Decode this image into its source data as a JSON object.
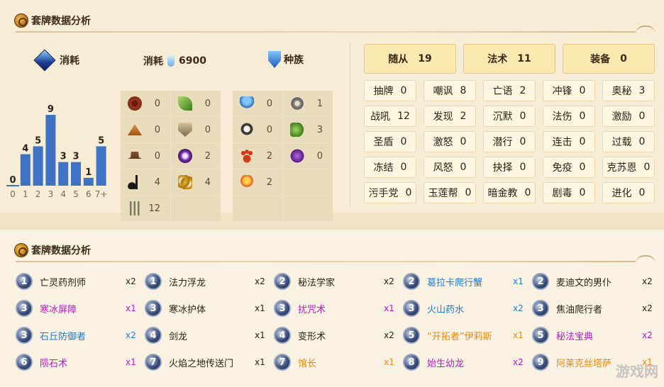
{
  "section_top": {
    "title": "套牌数据分析"
  },
  "section_bottom": {
    "title": "套牌数据分析"
  },
  "stats": {
    "cost_label": "消耗",
    "dust_label": "消耗",
    "dust_value": "6900",
    "race_label": "种族"
  },
  "chart_data": {
    "type": "bar",
    "categories": [
      "0",
      "1",
      "2",
      "3",
      "4",
      "5",
      "6",
      "7+"
    ],
    "values": [
      0,
      4,
      5,
      9,
      3,
      3,
      1,
      5
    ],
    "title": "",
    "xlabel": "",
    "ylabel": "",
    "ylim": [
      0,
      9
    ],
    "grid": false,
    "color": "#3d72c4"
  },
  "type_grid": [
    [
      {
        "icon": "spider-icon",
        "count": "0"
      },
      {
        "icon": "leaf-icon",
        "count": "0"
      }
    ],
    [
      {
        "icon": "pyramid-icon",
        "count": "0"
      },
      {
        "icon": "shield-icon",
        "count": "0"
      }
    ],
    [
      {
        "icon": "hat-icon",
        "count": "0"
      },
      {
        "icon": "purple-eye-icon",
        "count": "2"
      }
    ],
    [
      {
        "icon": "music-note-icon",
        "count": "4"
      },
      {
        "icon": "chain-icon",
        "count": "4"
      }
    ],
    [
      {
        "icon": "claw-icon",
        "count": "12"
      },
      {
        "icon": "",
        "count": ""
      }
    ]
  ],
  "race_grid": [
    [
      {
        "icon": "murloc-icon",
        "count": "0"
      },
      {
        "icon": "gear-icon",
        "count": "1"
      }
    ],
    [
      {
        "icon": "pirate-icon",
        "count": "0"
      },
      {
        "icon": "dragon-icon",
        "count": "3"
      }
    ],
    [
      {
        "icon": "paw-icon",
        "count": "2"
      },
      {
        "icon": "demon-icon",
        "count": "0"
      }
    ],
    [
      {
        "icon": "elemental-icon",
        "count": "2"
      },
      {
        "icon": "",
        "count": ""
      }
    ],
    [
      {
        "icon": "",
        "count": ""
      },
      {
        "icon": "",
        "count": ""
      }
    ]
  ],
  "card_types": [
    {
      "label": "随从",
      "count": "19"
    },
    {
      "label": "法术",
      "count": "11"
    },
    {
      "label": "装备",
      "count": "0"
    }
  ],
  "keywords": [
    [
      {
        "label": "抽牌",
        "count": "0"
      },
      {
        "label": "嘲讽",
        "count": "8"
      },
      {
        "label": "亡语",
        "count": "2"
      },
      {
        "label": "冲锋",
        "count": "0"
      },
      {
        "label": "奥秘",
        "count": "3"
      }
    ],
    [
      {
        "label": "战吼",
        "count": "12"
      },
      {
        "label": "发现",
        "count": "2"
      },
      {
        "label": "沉默",
        "count": "0"
      },
      {
        "label": "法伤",
        "count": "0"
      },
      {
        "label": "激励",
        "count": "0"
      }
    ],
    [
      {
        "label": "圣盾",
        "count": "0"
      },
      {
        "label": "激怒",
        "count": "0"
      },
      {
        "label": "潜行",
        "count": "0"
      },
      {
        "label": "连击",
        "count": "0"
      },
      {
        "label": "过载",
        "count": "0"
      }
    ],
    [
      {
        "label": "冻结",
        "count": "0"
      },
      {
        "label": "风怒",
        "count": "0"
      },
      {
        "label": "抉择",
        "count": "0"
      },
      {
        "label": "免疫",
        "count": "0"
      },
      {
        "label": "克苏恩",
        "count": "0"
      }
    ],
    [
      {
        "label": "污手党",
        "count": "0"
      },
      {
        "label": "玉莲帮",
        "count": "0"
      },
      {
        "label": "暗金教",
        "count": "0"
      },
      {
        "label": "剧毒",
        "count": "0"
      },
      {
        "label": "进化",
        "count": "0"
      }
    ]
  ],
  "cards": [
    [
      {
        "cost": "1",
        "name": "亡灵药剂师",
        "qty": "x2",
        "rarity": "common"
      },
      {
        "cost": "1",
        "name": "法力浮龙",
        "qty": "x2",
        "rarity": "common"
      },
      {
        "cost": "2",
        "name": "秘法学家",
        "qty": "x2",
        "rarity": "common"
      },
      {
        "cost": "2",
        "name": "葛拉卡爬行蟹",
        "qty": "x1",
        "rarity": "rare"
      },
      {
        "cost": "2",
        "name": "麦迪文的男仆",
        "qty": "x2",
        "rarity": "common"
      }
    ],
    [
      {
        "cost": "3",
        "name": "寒冰屏障",
        "qty": "x1",
        "rarity": "epic"
      },
      {
        "cost": "3",
        "name": "寒冰护体",
        "qty": "x1",
        "rarity": "common"
      },
      {
        "cost": "3",
        "name": "扰咒术",
        "qty": "x1",
        "rarity": "epic"
      },
      {
        "cost": "3",
        "name": "火山药水",
        "qty": "x2",
        "rarity": "rare"
      },
      {
        "cost": "3",
        "name": "焦油爬行者",
        "qty": "x2",
        "rarity": "common"
      }
    ],
    [
      {
        "cost": "3",
        "name": "石丘防御者",
        "qty": "x2",
        "rarity": "rare"
      },
      {
        "cost": "4",
        "name": "剑龙",
        "qty": "x1",
        "rarity": "common"
      },
      {
        "cost": "4",
        "name": "变形术",
        "qty": "x2",
        "rarity": "common"
      },
      {
        "cost": "5",
        "name": "“开拓者”伊莉斯",
        "qty": "x1",
        "rarity": "legend"
      },
      {
        "cost": "5",
        "name": "秘法宝典",
        "qty": "x2",
        "rarity": "epic"
      }
    ],
    [
      {
        "cost": "6",
        "name": "陨石术",
        "qty": "x1",
        "rarity": "epic"
      },
      {
        "cost": "7",
        "name": "火焰之地传送门",
        "qty": "x1",
        "rarity": "common"
      },
      {
        "cost": "7",
        "name": "馆长",
        "qty": "x1",
        "rarity": "legend"
      },
      {
        "cost": "8",
        "name": "始生幼龙",
        "qty": "x2",
        "rarity": "epic"
      },
      {
        "cost": "9",
        "name": "阿莱克丝塔萨",
        "qty": "x1",
        "rarity": "legend"
      }
    ]
  ],
  "watermark": "游戏网"
}
